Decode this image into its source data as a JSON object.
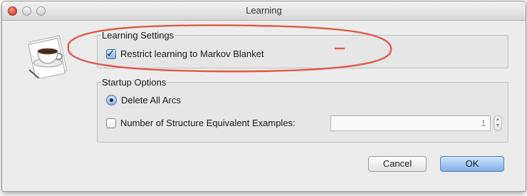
{
  "window": {
    "title": "Learning"
  },
  "learning_settings": {
    "legend": "Learning Settings",
    "restrict_label": "Restrict learning to Markov Blanket",
    "restrict_checked": true
  },
  "startup_options": {
    "legend": "Startup Options",
    "delete_arcs_label": "Delete All Arcs",
    "delete_arcs_selected": true,
    "equiv_examples_label": "Number of Structure Equivalent Examples:",
    "equiv_examples_checked": false,
    "equiv_examples_value": "1"
  },
  "buttons": {
    "cancel_label": "Cancel",
    "ok_label": "OK"
  },
  "annotation": {
    "color": "#e0584a"
  },
  "icons": {
    "app": "coffee-cup-icon",
    "stepper_up": "chevron-up-icon",
    "stepper_down": "chevron-down-icon"
  }
}
